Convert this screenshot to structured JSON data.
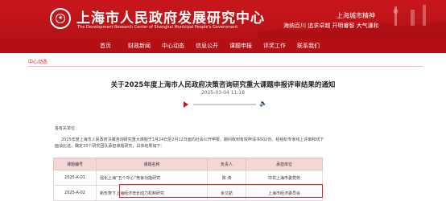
{
  "header": {
    "title": "上海市人民政府发展研究中心",
    "subtitle": "The Development Research Center of Shanghai Municipal People's Government",
    "slogan_title": "上海城市精神",
    "slogan": "海纳百川  追求卓越  开明睿智  大气谦和",
    "brand_color": "#c8171c"
  },
  "nav": [
    "首页",
    "财政新闻",
    "中心动态",
    "信息公开",
    "课题申报",
    "评奖工作",
    "联系我们"
  ],
  "breadcrumb": "中心动态",
  "article": {
    "title": "关于2025年度上海市人民政府决策咨询研究重大课题申报评审结果的通知",
    "date": "2025-03-04 11:18",
    "greeting": "各有关单位：",
    "paragraph1": "2025年度上海市人民政府决策咨询研究重大课题于1月24日至2月12日面向社会公开申报，期间收到有效申请书502份。经组织专家线上评审和线下",
    "paragraph2": "面谈比选，确定33个研究团队承担课题研究，具体结果如下："
  },
  "table": {
    "headers": [
      "课题编号",
      "课题名称",
      "负责人",
      "承担单位"
    ],
    "rows": [
      [
        "2025-A-01",
        "强化上海“五个中心”竞争功能研究",
        "陈 涛",
        "中共上海市委党校"
      ],
      [
        "2025-A-02",
        "新形势下上海经济增长动力机制研究",
        "余文航",
        "上海市经济委员会"
      ]
    ]
  }
}
